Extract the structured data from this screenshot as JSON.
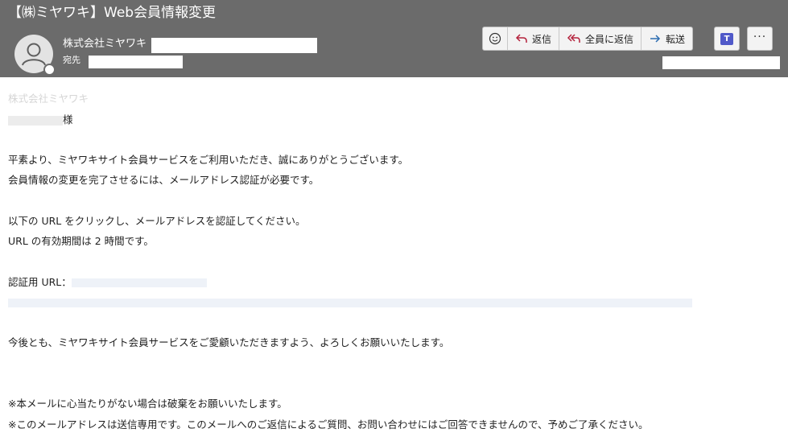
{
  "subject": "【㈱ミヤワキ】Web会員情報変更",
  "sender": {
    "name": "株式会社ミヤワキ"
  },
  "to_label": "宛先",
  "actions": {
    "reply": "返信",
    "reply_all": "全員に返信",
    "forward": "転送"
  },
  "body": {
    "company": "株式会社ミヤワキ",
    "salutation": "様",
    "p1_line1": "平素より、ミヤワキサイト会員サービスをご利用いただき、誠にありがとうございます。",
    "p1_line2": "会員情報の変更を完了させるには、メールアドレス認証が必要です。",
    "p2_line1": "以下の URL をクリックし、メールアドレスを認証してください。",
    "p2_line2": "URL の有効期間は 2 時間です。",
    "auth_label": "認証用 URL：",
    "p3_line1": "今後とも、ミヤワキサイト会員サービスをご愛顧いただきますよう、よろしくお願いいたします。",
    "note1": "※本メールに心当たりがない場合は破棄をお願いいたします。",
    "note2": "※このメールアドレスは送信専用です。このメールへのご返信によるご質問、お問い合わせにはご回答できませんので、予めご了承ください。"
  },
  "colors": {
    "header_bg": "#6b6b6b",
    "reply_icon": "#b4223c",
    "forward_icon": "#2b6cb0",
    "teams": "#5059c9"
  }
}
